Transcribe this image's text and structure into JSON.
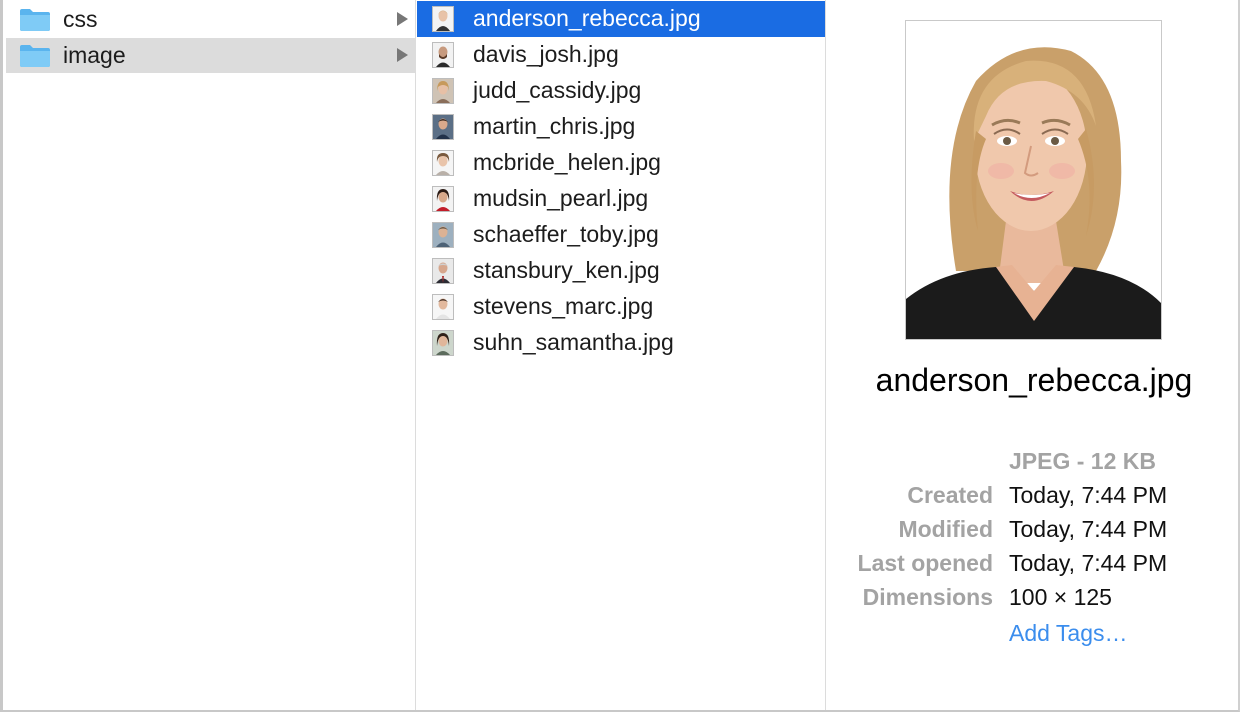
{
  "folders": [
    {
      "label": "css",
      "selected": false
    },
    {
      "label": "image",
      "selected": true
    }
  ],
  "files": [
    {
      "label": "anderson_rebecca.jpg",
      "selected": true
    },
    {
      "label": "davis_josh.jpg",
      "selected": false
    },
    {
      "label": "judd_cassidy.jpg",
      "selected": false
    },
    {
      "label": "martin_chris.jpg",
      "selected": false
    },
    {
      "label": "mcbride_helen.jpg",
      "selected": false
    },
    {
      "label": "mudsin_pearl.jpg",
      "selected": false
    },
    {
      "label": "schaeffer_toby.jpg",
      "selected": false
    },
    {
      "label": "stansbury_ken.jpg",
      "selected": false
    },
    {
      "label": "stevens_marc.jpg",
      "selected": false
    },
    {
      "label": "suhn_samantha.jpg",
      "selected": false
    }
  ],
  "preview": {
    "file_name": "anderson_rebecca.jpg",
    "kind": "JPEG - 12 KB",
    "meta": [
      {
        "key": "Created",
        "value": "Today, 7:44 PM"
      },
      {
        "key": "Modified",
        "value": "Today, 7:44 PM"
      },
      {
        "key": "Last opened",
        "value": "Today, 7:44 PM"
      },
      {
        "key": "Dimensions",
        "value": "100 × 125"
      }
    ],
    "add_tags": "Add Tags…"
  },
  "colors": {
    "selection": "#1a6ce3",
    "folder_selected_bg": "#dcdcdc",
    "folder_icon": "#6cc0f3",
    "link": "#3b8ded",
    "meta_key": "#a3a3a3"
  },
  "icons": {
    "folder": "folder-icon",
    "chevron": "chevron-right-icon",
    "thumbnail": "image-thumbnail-icon"
  }
}
